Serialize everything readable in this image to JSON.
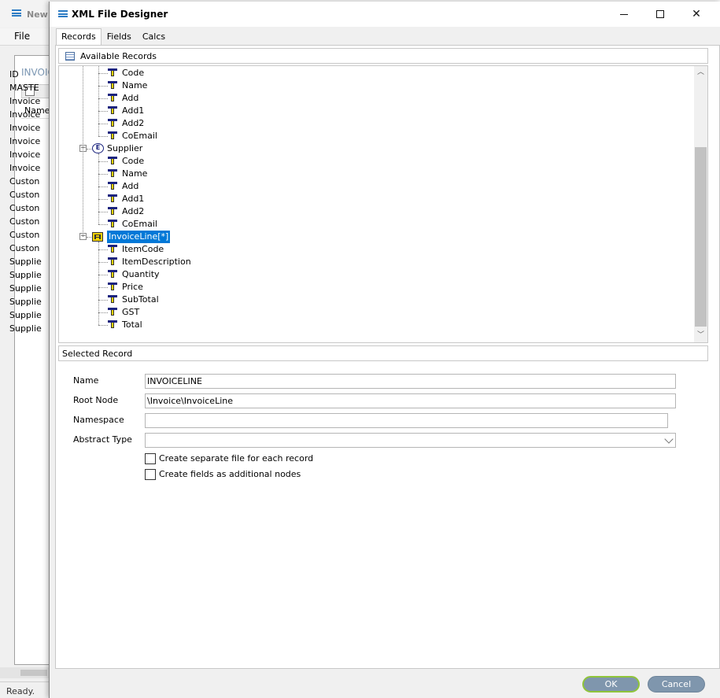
{
  "background_app": {
    "title_partial": "New I",
    "menu": {
      "file": "File"
    },
    "panel_header": "INVOIC",
    "column_header": "Name",
    "list_items": [
      "ID",
      "MASTE",
      "Invoice",
      "Invoice",
      "Invoice",
      "Invoice",
      "Invoice",
      "Invoice",
      "Custon",
      "Custon",
      "Custon",
      "Custon",
      "Custon",
      "Custon",
      "Supplie",
      "Supplie",
      "Supplie",
      "Supplie",
      "Supplie",
      "Supplie"
    ],
    "status": "Ready."
  },
  "dialog": {
    "title": "XML File Designer",
    "tabs": [
      {
        "label": "Records",
        "active": true
      },
      {
        "label": "Fields",
        "active": false
      },
      {
        "label": "Calcs",
        "active": false
      }
    ],
    "available_records_label": "Available Records",
    "tree": {
      "customer_fields": [
        "Code",
        "Name",
        "Add",
        "Add1",
        "Add2",
        "CoEmail"
      ],
      "supplier": {
        "label": "Supplier",
        "icon": "element-icon",
        "fields": [
          "Code",
          "Name",
          "Add",
          "Add1",
          "Add2",
          "CoEmail"
        ]
      },
      "invoice_line": {
        "label": "InvoiceLine[*]",
        "icon": "record-icon",
        "selected": true,
        "fields": [
          "ItemCode",
          "ItemDescription",
          "Quantity",
          "Price",
          "SubTotal",
          "GST",
          "Total"
        ]
      }
    },
    "selected_record_label": "Selected Record",
    "form": {
      "name": {
        "label": "Name",
        "value": "INVOICELINE"
      },
      "root_node": {
        "label": "Root Node",
        "value": "\\Invoice\\InvoiceLine"
      },
      "namespace": {
        "label": "Namespace",
        "value": ""
      },
      "abstract_type": {
        "label": "Abstract Type",
        "value": ""
      },
      "separate_file": {
        "label": "Create separate file for each record",
        "checked": false
      },
      "additional_nodes": {
        "label": "Create fields as additional nodes",
        "checked": false
      }
    },
    "buttons": {
      "ok": "OK",
      "cancel": "Cancel"
    },
    "colors": {
      "selection": "#0078d7",
      "button": "#7f96ad",
      "ok_focus": "#8fc43a",
      "field_icon_top": "#1a237e",
      "field_icon_stem": "#f2d300"
    }
  }
}
